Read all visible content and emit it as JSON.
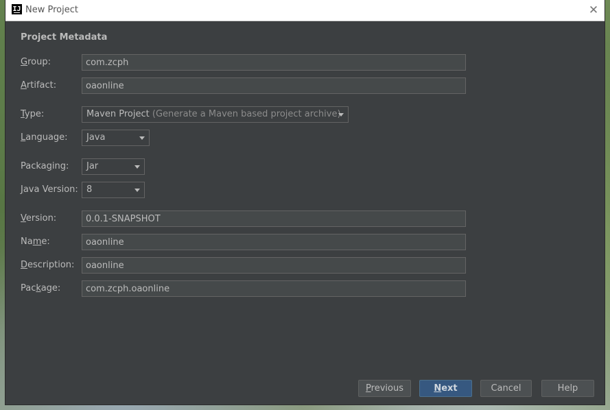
{
  "window": {
    "title": "New Project",
    "close_glyph": "✕",
    "app_icon_glyph": "IJ"
  },
  "section_title": "Project Metadata",
  "fields": {
    "group": {
      "label_mnemonic": "G",
      "label_rest": "roup:",
      "value": "com.zcph"
    },
    "artifact": {
      "label_mnemonic": "A",
      "label_rest": "rtifact:",
      "value": "oaonline"
    },
    "type": {
      "label_mnemonic": "T",
      "label_rest": "ype:",
      "value": "Maven Project",
      "hint": "(Generate a Maven based project archive)"
    },
    "language": {
      "label_mnemonic": "L",
      "label_rest": "anguage:",
      "value": "Java"
    },
    "packaging": {
      "label_pre": "Packa",
      "label_mnemonic": "g",
      "label_rest": "ing:",
      "value": "Jar"
    },
    "java_version": {
      "label_mnemonic": "J",
      "label_rest": "ava Version:",
      "value": "8"
    },
    "version": {
      "label_mnemonic": "V",
      "label_rest": "ersion:",
      "value": "0.0.1-SNAPSHOT"
    },
    "name": {
      "label_pre": "Na",
      "label_mnemonic": "m",
      "label_rest": "e:",
      "value": "oaonline"
    },
    "description": {
      "label_mnemonic": "D",
      "label_rest": "escription:",
      "value": "oaonline"
    },
    "package": {
      "label_pre": "Pac",
      "label_mnemonic": "k",
      "label_rest": "age:",
      "value": "com.zcph.oaonline"
    }
  },
  "buttons": {
    "previous": {
      "mnemonic": "P",
      "rest": "revious"
    },
    "next": {
      "mnemonic": "N",
      "rest": "ext"
    },
    "cancel": "Cancel",
    "help": "Help"
  },
  "colors": {
    "dialog_bg": "#3c3f41",
    "field_bg": "#45494a",
    "text": "#bbbbbb",
    "primary_button": "#365880"
  }
}
